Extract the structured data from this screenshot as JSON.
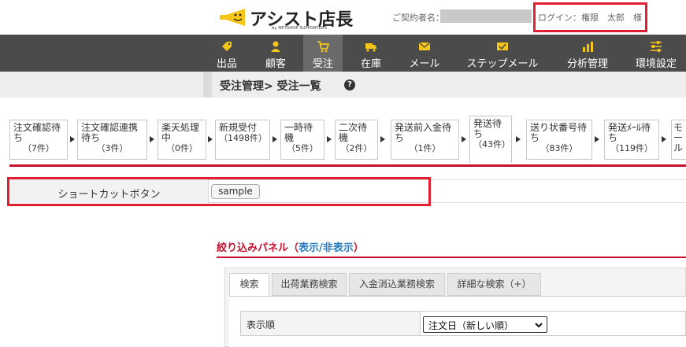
{
  "header": {
    "brand": "アシスト店長",
    "brand_sub": "by NETSHOP SUPPORTERS",
    "contract_label": "ご契約者名：",
    "login_text": "ログイン：権限　太郎　様"
  },
  "nav": {
    "items": [
      {
        "label": "出品",
        "icon": "tag-icon"
      },
      {
        "label": "顧客",
        "icon": "user-icon"
      },
      {
        "label": "受注",
        "icon": "cart-icon",
        "active": true
      },
      {
        "label": "在庫",
        "icon": "truck-icon"
      },
      {
        "label": "メール",
        "icon": "mail-icon"
      },
      {
        "label": "ステップメール",
        "icon": "step-mail-icon"
      },
      {
        "label": "分析管理",
        "icon": "chart-icon"
      },
      {
        "label": "環境設定",
        "icon": "sliders-icon"
      }
    ]
  },
  "page": {
    "title": "受注管理> 受注一覧",
    "help": "?"
  },
  "statuses": [
    {
      "name": "注文確認待ち",
      "count": "（7件）"
    },
    {
      "name": "注文確認連携待ち",
      "count": "（3件）"
    },
    {
      "name": "楽天処理中",
      "count": "（0件）"
    },
    {
      "name": "新規受付",
      "count": "（1498件）"
    },
    {
      "name": "一時待機",
      "count": "（5件）"
    },
    {
      "name": "二次待機",
      "count": "（2件）"
    },
    {
      "name": "発送前入金待ち",
      "count": "（1件）"
    },
    {
      "name": "発送待ち",
      "count": "（43件）"
    },
    {
      "name": "送り状番号待ち",
      "count": "（83件）"
    },
    {
      "name": "発送ﾒｰﾙ待ち",
      "count": "（119件）"
    },
    {
      "name": "モール",
      "count": ""
    }
  ],
  "shortcut": {
    "label": "ショートカットボタン",
    "button": "sample"
  },
  "filter": {
    "title": "絞り込みパネル",
    "open_paren": "（",
    "show": "表示",
    "slash": "/",
    "hide": "非表示",
    "close_paren": "）",
    "tabs": [
      "検索",
      "出荷業務検索",
      "入金消込業務検索",
      "詳細な検索（+）"
    ],
    "sort_label": "表示順",
    "sort_value": "注文日（新しい順）"
  },
  "colors": {
    "accent_red": "#c8102e",
    "highlight_red": "#e02030",
    "nav_bg": "#4b4b4b",
    "icon_yellow": "#f5c518",
    "link_blue": "#2a7bc0"
  }
}
